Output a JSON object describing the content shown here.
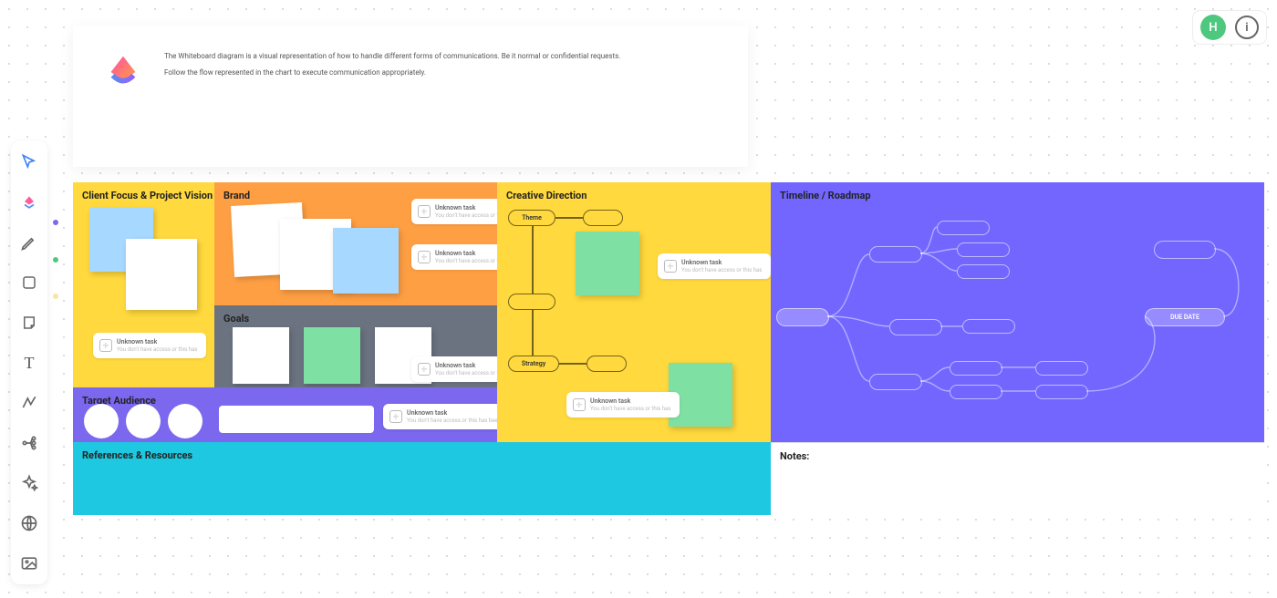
{
  "topbar": {
    "avatar_initial": "H"
  },
  "header": {
    "line1": "The Whiteboard diagram is a visual representation of how to handle different forms of communications. Be it normal or confidential requests.",
    "line2": "Follow the flow represented in the chart to execute communication appropriately."
  },
  "toolbar": {
    "select": "Select",
    "clickup": "ClickUp",
    "pen": "Draw",
    "shape": "Shape",
    "sticky": "Sticky note",
    "text": "Text",
    "connector": "Connector",
    "mind": "Mind map",
    "ai": "AI",
    "web": "Embed",
    "image": "Image"
  },
  "panels": {
    "client_focus": "Client Focus & Project Vision",
    "brand": "Brand",
    "goals": "Goals",
    "target_audience": "Target Audience",
    "creative_direction": "Creative Direction",
    "timeline": "Timeline / Roadmap",
    "references": "References & Resources",
    "notes": "Notes:"
  },
  "creative": {
    "theme": "Theme",
    "strategy": "Strategy"
  },
  "timeline": {
    "due_date": "DUE DATE"
  },
  "task": {
    "title": "Unknown task",
    "subtitle": "You don't have access or this has been deleted"
  },
  "colors": {
    "yellow": "#ffd93d",
    "orange": "#ff9f43",
    "grey": "#6b7280",
    "purple": "#7b68ee",
    "violet": "#7366ff",
    "cyan": "#1ec8e0",
    "mint": "#7ee0a2",
    "blue": "#a7d8ff"
  }
}
